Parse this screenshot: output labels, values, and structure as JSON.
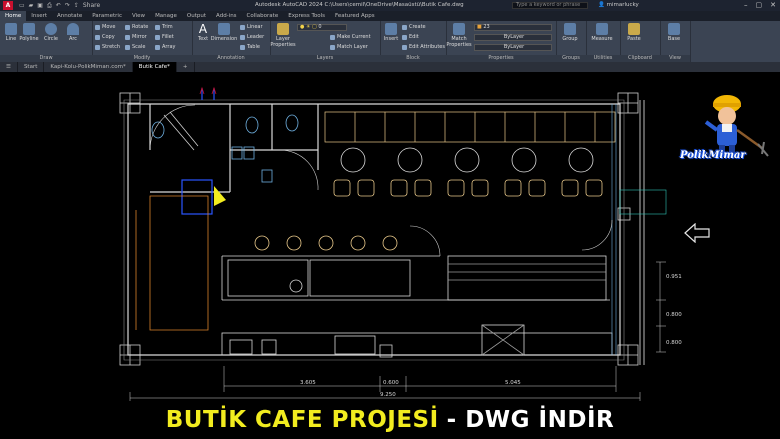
{
  "app": {
    "logo": "A",
    "title": "Autodesk AutoCAD 2024    C:\\Users\\cemil\\OneDrive\\Masaüstü\\Butik Cafe.dwg",
    "share": "Share",
    "search_placeholder": "Type a keyword or phrase",
    "user": "mimarlucky"
  },
  "ribbon_tabs": [
    "Home",
    "Insert",
    "Annotate",
    "Parametric",
    "View",
    "Manage",
    "Output",
    "Add-ins",
    "Collaborate",
    "Express Tools",
    "Featured Apps"
  ],
  "ribbon": {
    "draw": {
      "title": "Draw",
      "line": "Line",
      "polyline": "Polyline",
      "circle": "Circle",
      "arc": "Arc"
    },
    "modify": {
      "title": "Modify",
      "move": "Move",
      "rotate": "Rotate",
      "trim": "Trim",
      "copy": "Copy",
      "mirror": "Mirror",
      "fillet": "Fillet",
      "stretch": "Stretch",
      "scale": "Scale",
      "array": "Array"
    },
    "annotation": {
      "title": "Annotation",
      "text": "Text",
      "dimension": "Dimension",
      "linear": "Linear",
      "leader": "Leader",
      "table": "Table"
    },
    "layers": {
      "title": "Layers",
      "layer_properties": "Layer Properties",
      "current_layer": "0",
      "make_current": "Make Current",
      "match_layer": "Match Layer"
    },
    "block": {
      "title": "Block",
      "insert": "Insert",
      "create": "Create",
      "edit": "Edit",
      "edit_attributes": "Edit Attributes"
    },
    "properties": {
      "title": "Properties",
      "match_properties": "Match Properties",
      "color_value": "23",
      "linetype": "ByLayer",
      "lineweight": "ByLayer"
    },
    "groups": {
      "title": "Groups",
      "group": "Group"
    },
    "utilities": {
      "title": "Utilities",
      "measure": "Measure"
    },
    "clipboard": {
      "title": "Clipboard",
      "paste": "Paste"
    },
    "view": {
      "title": "View",
      "base": "Base"
    }
  },
  "file_tabs": [
    "Start",
    "Kapi-Kolu-PolikMimarı.com*",
    "Butik Cafe*"
  ],
  "drawing": {
    "dim_bottom_left": "3.605",
    "dim_bottom_mid": "0.600",
    "dim_bottom_right": "5.045",
    "dim_total": "9.250",
    "dim_right_top": "0.951",
    "dim_right_mid": "0.800",
    "dim_right_bottom": "0.800"
  },
  "brand": {
    "name": "PolikMimar"
  },
  "banner": {
    "main": "BUTİK CAFE PROJESİ",
    "sub": "- DWG İNDİR"
  },
  "colors": {
    "accent_banner": "#f2ec1f",
    "autocad_red": "#c8102e",
    "wall": "#d9d9d9",
    "furniture": "#e8c88a",
    "wet": "#6fb0e0"
  }
}
